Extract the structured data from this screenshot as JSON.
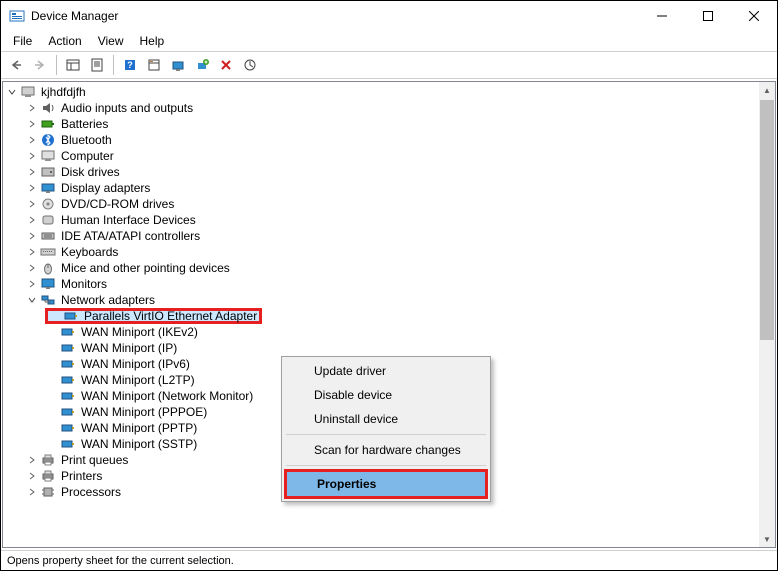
{
  "window": {
    "title": "Device Manager"
  },
  "menubar": [
    "File",
    "Action",
    "View",
    "Help"
  ],
  "root_node": "kjhdfdjfh",
  "categories": [
    {
      "label": "Audio inputs and outputs",
      "icon": "audio"
    },
    {
      "label": "Batteries",
      "icon": "battery"
    },
    {
      "label": "Bluetooth",
      "icon": "bluetooth"
    },
    {
      "label": "Computer",
      "icon": "computer"
    },
    {
      "label": "Disk drives",
      "icon": "disk"
    },
    {
      "label": "Display adapters",
      "icon": "display"
    },
    {
      "label": "DVD/CD-ROM drives",
      "icon": "optical"
    },
    {
      "label": "Human Interface Devices",
      "icon": "hid"
    },
    {
      "label": "IDE ATA/ATAPI controllers",
      "icon": "ide"
    },
    {
      "label": "Keyboards",
      "icon": "keyboard"
    },
    {
      "label": "Mice and other pointing devices",
      "icon": "mouse"
    },
    {
      "label": "Monitors",
      "icon": "monitor"
    },
    {
      "label": "Network adapters",
      "icon": "network",
      "expanded": true
    },
    {
      "label": "Print queues",
      "icon": "printer"
    },
    {
      "label": "Printers",
      "icon": "printer"
    },
    {
      "label": "Processors",
      "icon": "cpu"
    }
  ],
  "network_children": [
    {
      "label": "Parallels VirtIO Ethernet Adapter",
      "highlighted": true
    },
    {
      "label": "WAN Miniport (IKEv2)"
    },
    {
      "label": "WAN Miniport (IP)"
    },
    {
      "label": "WAN Miniport (IPv6)"
    },
    {
      "label": "WAN Miniport (L2TP)"
    },
    {
      "label": "WAN Miniport (Network Monitor)"
    },
    {
      "label": "WAN Miniport (PPPOE)"
    },
    {
      "label": "WAN Miniport (PPTP)"
    },
    {
      "label": "WAN Miniport (SSTP)"
    }
  ],
  "context_menu": [
    {
      "label": "Update driver"
    },
    {
      "label": "Disable device"
    },
    {
      "label": "Uninstall device"
    },
    {
      "sep": true
    },
    {
      "label": "Scan for hardware changes"
    },
    {
      "sep": true
    },
    {
      "label": "Properties",
      "highlighted": true
    }
  ],
  "statusbar": "Opens property sheet for the current selection."
}
